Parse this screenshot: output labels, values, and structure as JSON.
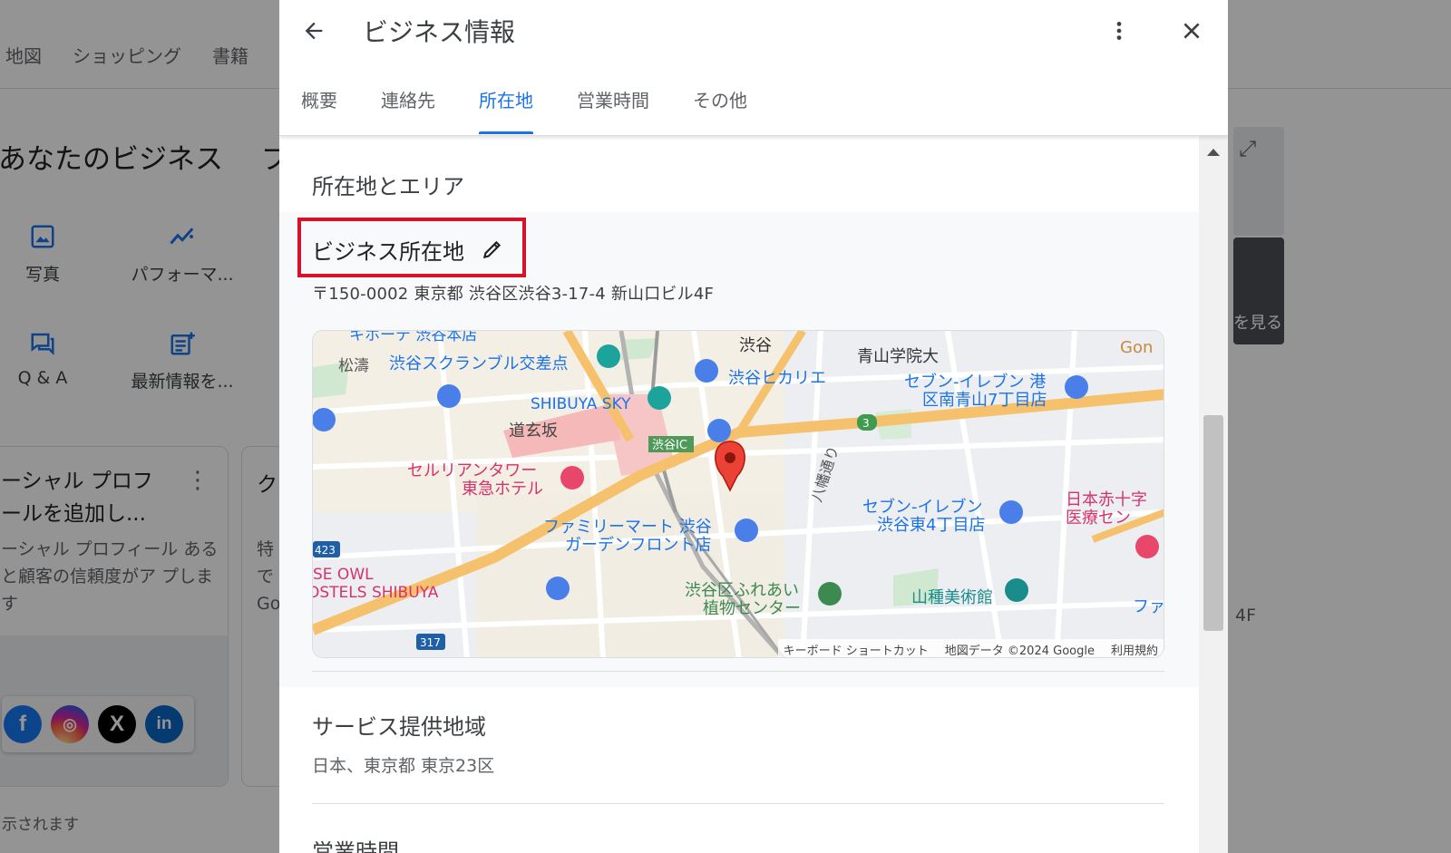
{
  "background": {
    "tabs": [
      "地図",
      "ショッピング",
      "書籍"
    ],
    "title": "あなたのビジネス",
    "title2": "プ",
    "actions": [
      {
        "label": "写真",
        "icon": "photo-icon"
      },
      {
        "label": "パフォーマ...",
        "icon": "performance-icon"
      },
      {
        "label": "Q & A",
        "icon": "qa-icon"
      },
      {
        "label": "最新情報を...",
        "icon": "post-icon"
      }
    ],
    "card": {
      "title": "ーシャル プロフ ールを追加し...",
      "description": "ーシャル プロフィール あると顧客の信頼度がア プします"
    },
    "card2": {
      "title": "ク",
      "description": "特 で Go"
    },
    "social_icons": [
      "facebook-icon",
      "instagram-icon",
      "x-icon",
      "linkedin-icon"
    ],
    "footer_text": "示されます",
    "right_photo_text": "を見る",
    "right_text": "4F"
  },
  "modal": {
    "title": "ビジネス情報",
    "tabs": [
      {
        "label": "概要",
        "active": false
      },
      {
        "label": "連絡先",
        "active": false
      },
      {
        "label": "所在地",
        "active": true
      },
      {
        "label": "営業時間",
        "active": false
      },
      {
        "label": "その他",
        "active": false
      }
    ],
    "section_heading": "所在地とエリア",
    "location": {
      "label": "ビジネス所在地",
      "address": "〒150-0002 東京都 渋谷区渋谷3-17-4 新山口ビル4F"
    },
    "map": {
      "labels": {
        "top_cut": "キホーテ 渋谷本店",
        "matsu": "松濤",
        "scramble": "渋谷スクランブル交差点",
        "hikarie": "渋谷ヒカリエ",
        "shibuya": "渋谷",
        "aoyama": "青山学院大",
        "gon": "Gon",
        "seven_aoyama_1": "セブン-イレブン 港",
        "seven_aoyama_2": "区南青山7丁目店",
        "sky": "SHIBUYA SKY",
        "dogenzaka": "道玄坂",
        "ic": "渋谷IC",
        "cerulean_1": "セルリアンタワー",
        "cerulean_2": "東急ホテル",
        "hachiman": "八幡通り",
        "seven_higashi_1": "セブン-イレブン",
        "seven_higashi_2": "渋谷東4丁目店",
        "redcross_1": "日本赤十字",
        "redcross_2": "医療セン",
        "famima_1": "ファミリーマート 渋谷",
        "famima_2": "ガーデンフロント店",
        "owl_1": "SE OWL",
        "owl_2": "OSTELS SHIBUYA",
        "fureai_1": "渋谷区ふれあい",
        "fureai_2": "植物センター",
        "yamatane": "山種美術館",
        "fa": "ファ",
        "route3": "3",
        "route423": "423",
        "route317": "317"
      },
      "attribution": {
        "shortcuts": "キーボード ショートカット",
        "data": "地図データ ©2024 Google",
        "terms": "利用規約"
      }
    },
    "service_area": {
      "label": "サービス提供地域",
      "value": "日本、東京都 東京23区"
    },
    "hours_label": "営業時間"
  },
  "colors": {
    "accent": "#1a73e8",
    "highlight": "#d9102a",
    "pin": "#ea4335"
  }
}
